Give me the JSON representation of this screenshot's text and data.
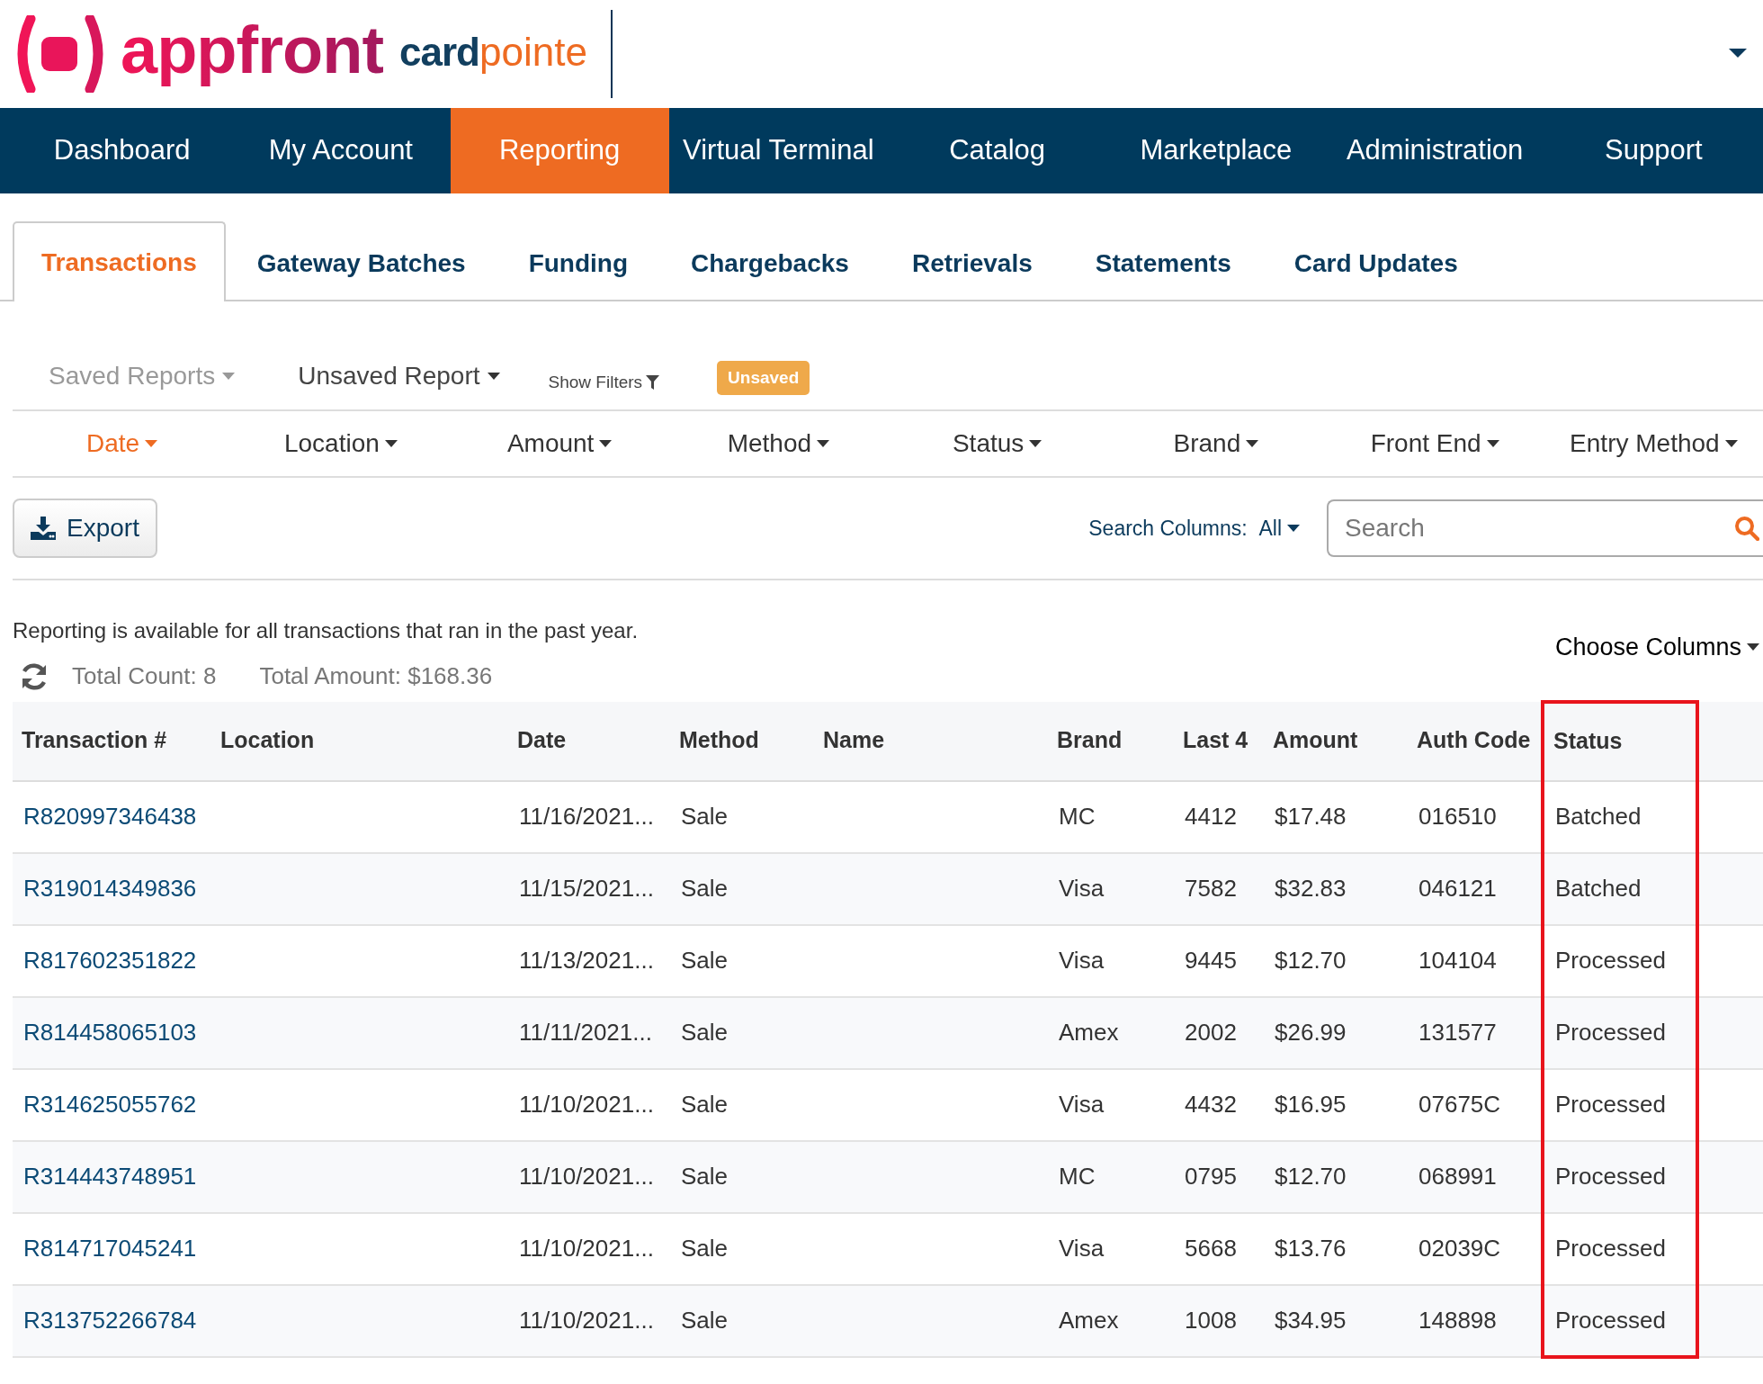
{
  "logo": {
    "brand": "appfront",
    "product_prefix": "card",
    "product_suffix": "pointe"
  },
  "main_nav": [
    {
      "label": "Dashboard",
      "selected": false
    },
    {
      "label": "My Account",
      "selected": false
    },
    {
      "label": "Reporting",
      "selected": true
    },
    {
      "label": "Virtual Terminal",
      "selected": false
    },
    {
      "label": "Catalog",
      "selected": false
    },
    {
      "label": "Marketplace",
      "selected": false
    },
    {
      "label": "Administration",
      "selected": false
    },
    {
      "label": "Support",
      "selected": false
    }
  ],
  "sub_tabs": [
    {
      "label": "Transactions",
      "selected": true
    },
    {
      "label": "Gateway Batches",
      "selected": false
    },
    {
      "label": "Funding",
      "selected": false
    },
    {
      "label": "Chargebacks",
      "selected": false
    },
    {
      "label": "Retrievals",
      "selected": false
    },
    {
      "label": "Statements",
      "selected": false
    },
    {
      "label": "Card Updates",
      "selected": false
    }
  ],
  "report_bar": {
    "saved_reports": "Saved Reports",
    "current_report": "Unsaved Report",
    "show_filters": "Show Filters",
    "badge": "Unsaved"
  },
  "filters": [
    {
      "label": "Date",
      "selected": true
    },
    {
      "label": "Location",
      "selected": false
    },
    {
      "label": "Amount",
      "selected": false
    },
    {
      "label": "Method",
      "selected": false
    },
    {
      "label": "Status",
      "selected": false
    },
    {
      "label": "Brand",
      "selected": false
    },
    {
      "label": "Front End",
      "selected": false
    },
    {
      "label": "Entry Method",
      "selected": false
    }
  ],
  "export_button": "Export",
  "search": {
    "columns_label": "Search Columns:",
    "columns_value": "All",
    "placeholder": "Search"
  },
  "notice": "Reporting is available for all transactions that ran in the past year.",
  "choose_columns": "Choose Columns",
  "totals": {
    "count": "Total Count: 8",
    "amount": "Total Amount: $168.36"
  },
  "table": {
    "columns": [
      {
        "label": "Transaction #",
        "highlighted": false
      },
      {
        "label": "Location",
        "highlighted": false
      },
      {
        "label": "Date",
        "highlighted": false
      },
      {
        "label": "Method",
        "highlighted": false
      },
      {
        "label": "Name",
        "highlighted": false
      },
      {
        "label": "Brand",
        "highlighted": false
      },
      {
        "label": "Last 4",
        "highlighted": false
      },
      {
        "label": "Amount",
        "highlighted": false
      },
      {
        "label": "Auth Code",
        "highlighted": false
      },
      {
        "label": "Status",
        "highlighted": true
      }
    ],
    "rows": [
      {
        "transaction_number": "R820997346438",
        "date": "11/16/2021...",
        "method": "Sale",
        "brand": "MC",
        "last_4": "4412",
        "amount": "$17.48",
        "auth_code": "016510",
        "status": "Batched"
      },
      {
        "transaction_number": "R319014349836",
        "date": "11/15/2021...",
        "method": "Sale",
        "brand": "Visa",
        "last_4": "7582",
        "amount": "$32.83",
        "auth_code": "046121",
        "status": "Batched"
      },
      {
        "transaction_number": "R817602351822",
        "date": "11/13/2021...",
        "method": "Sale",
        "brand": "Visa",
        "last_4": "9445",
        "amount": "$12.70",
        "auth_code": "104104",
        "status": "Processed"
      },
      {
        "transaction_number": "R814458065103",
        "date": "11/11/2021...",
        "method": "Sale",
        "brand": "Amex",
        "last_4": "2002",
        "amount": "$26.99",
        "auth_code": "131577",
        "status": "Processed"
      },
      {
        "transaction_number": "R314625055762",
        "date": "11/10/2021...",
        "method": "Sale",
        "brand": "Visa",
        "last_4": "4432",
        "amount": "$16.95",
        "auth_code": "07675C",
        "status": "Processed"
      },
      {
        "transaction_number": "R314443748951",
        "date": "11/10/2021...",
        "method": "Sale",
        "brand": "MC",
        "last_4": "0795",
        "amount": "$12.70",
        "auth_code": "068991",
        "status": "Processed"
      },
      {
        "transaction_number": "R814717045241",
        "date": "11/10/2021...",
        "method": "Sale",
        "brand": "Visa",
        "last_4": "5668",
        "amount": "$13.76",
        "auth_code": "02039C",
        "status": "Processed"
      },
      {
        "transaction_number": "R313752266784",
        "date": "11/10/2021...",
        "method": "Sale",
        "brand": "Amex",
        "last_4": "1008",
        "amount": "$34.95",
        "auth_code": "148898",
        "status": "Processed"
      }
    ]
  }
}
